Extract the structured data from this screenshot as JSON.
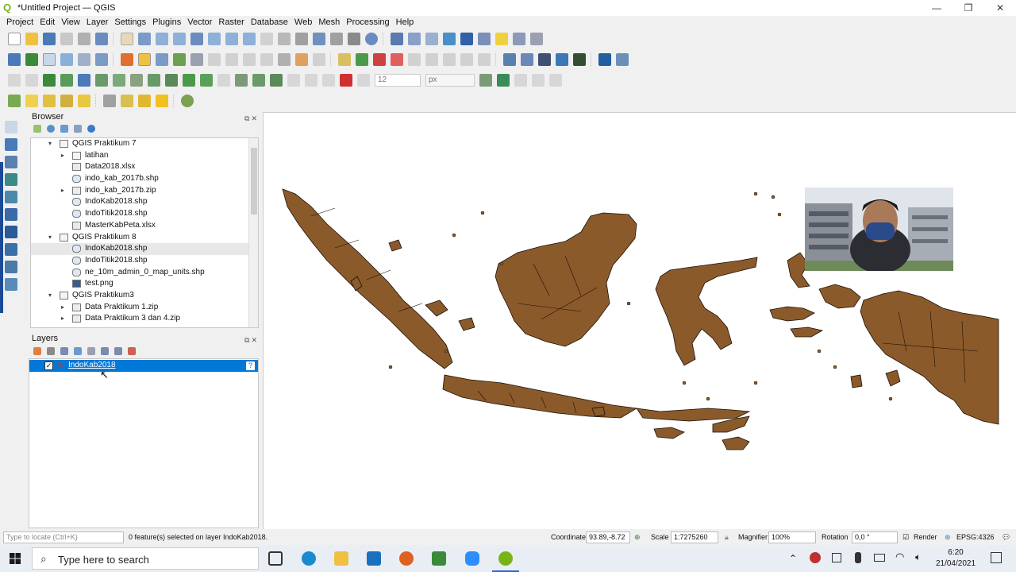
{
  "window": {
    "title": "*Untitled Project — QGIS",
    "controls": [
      "—",
      "❐",
      "✕"
    ]
  },
  "menu": [
    "Project",
    "Edit",
    "View",
    "Layer",
    "Settings",
    "Plugins",
    "Vector",
    "Raster",
    "Database",
    "Web",
    "Mesh",
    "Processing",
    "Help"
  ],
  "snapping": {
    "tolerance": "12",
    "unit": "px"
  },
  "browser": {
    "title": "Browser",
    "items": [
      {
        "label": "QGIS Praktikum 7",
        "level": 1,
        "expander": "▾",
        "icon": "folder-icon"
      },
      {
        "label": "latihan",
        "level": 2,
        "expander": "▸",
        "icon": "folder-icon"
      },
      {
        "label": "Data2018.xlsx",
        "level": 2,
        "expander": "",
        "icon": "table-icon"
      },
      {
        "label": "indo_kab_2017b.shp",
        "level": 2,
        "expander": "",
        "icon": "polygon-layer-icon"
      },
      {
        "label": "indo_kab_2017b.zip",
        "level": 2,
        "expander": "▸",
        "icon": "zip-icon"
      },
      {
        "label": "IndoKab2018.shp",
        "level": 2,
        "expander": "",
        "icon": "polygon-layer-icon"
      },
      {
        "label": "IndoTitik2018.shp",
        "level": 2,
        "expander": "",
        "icon": "polygon-layer-icon"
      },
      {
        "label": "MasterKabPeta.xlsx",
        "level": 2,
        "expander": "",
        "icon": "table-icon"
      },
      {
        "label": "QGIS Praktikum 8",
        "level": 1,
        "expander": "▾",
        "icon": "folder-icon"
      },
      {
        "label": "IndoKab2018.shp",
        "level": 2,
        "expander": "",
        "icon": "polygon-layer-icon",
        "selected": true
      },
      {
        "label": "IndoTitik2018.shp",
        "level": 2,
        "expander": "",
        "icon": "polygon-layer-icon"
      },
      {
        "label": "ne_10m_admin_0_map_units.shp",
        "level": 2,
        "expander": "",
        "icon": "polygon-layer-icon"
      },
      {
        "label": "test.png",
        "level": 2,
        "expander": "",
        "icon": "raster-icon"
      },
      {
        "label": "QGIS Praktikum3",
        "level": 1,
        "expander": "▾",
        "icon": "folder-icon"
      },
      {
        "label": "Data Praktikum 1.zip",
        "level": 2,
        "expander": "▸",
        "icon": "zip-icon"
      },
      {
        "label": "Data Praktikum 3 dan 4.zip",
        "level": 2,
        "expander": "▸",
        "icon": "zip-icon"
      }
    ]
  },
  "layers": {
    "title": "Layers",
    "items": [
      {
        "label": "IndoKab2018",
        "checked": true,
        "check_mark": "✓",
        "help": "?"
      }
    ]
  },
  "map": {
    "fill_color": "#8b5a2b",
    "stroke_color": "#1a1008"
  },
  "status": {
    "locate_placeholder": "Type to locate (Ctrl+K)",
    "message": "0 feature(s) selected on layer IndoKab2018.",
    "coordinate_label": "Coordinate",
    "coordinate": "93.89,-8.72",
    "scale_label": "Scale",
    "scale": "1:7275260",
    "magnifier_label": "Magnifier",
    "magnifier": "100%",
    "rotation_label": "Rotation",
    "rotation": "0,0 °",
    "render_label": "Render",
    "crs": "EPSG:4326"
  },
  "taskbar": {
    "search_placeholder": "Type here to search",
    "time": "6:20",
    "date": "21/04/2021"
  }
}
